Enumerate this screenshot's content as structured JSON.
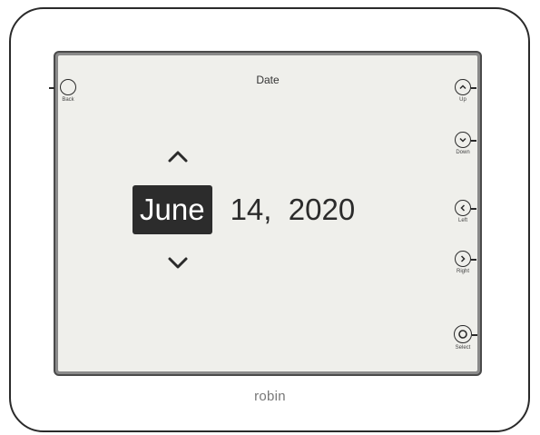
{
  "screen": {
    "title": "Date",
    "date": {
      "selected_field": "month",
      "month": "June",
      "day_year": "14,  2020"
    }
  },
  "buttons": {
    "back": "Back",
    "up": "Up",
    "down": "Down",
    "left": "Left",
    "right": "Right",
    "select": "Select"
  },
  "device": {
    "brand": "robin"
  },
  "icons": {
    "increment": "chevron-up-icon",
    "decrement": "chevron-down-icon",
    "up": "circle-chevron-up-icon",
    "down": "circle-chevron-down-icon",
    "left": "circle-chevron-left-icon",
    "right": "circle-chevron-right-icon",
    "select": "circle-dot-icon"
  },
  "colors": {
    "screen_bg": "#efefeb",
    "selection_bg": "#2c2c2c",
    "selection_text": "#ffffff"
  }
}
